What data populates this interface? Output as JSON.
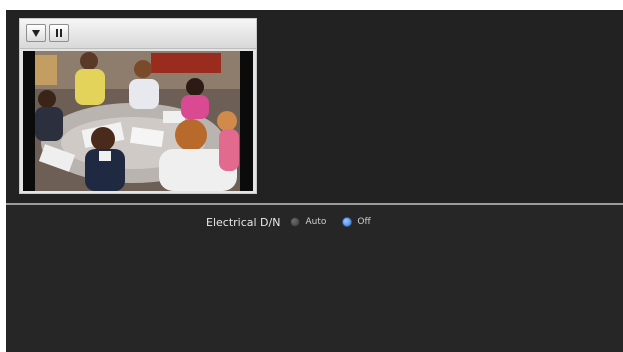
{
  "viewer": {
    "menu_icon": "triangle-down-icon",
    "pause_icon": "pause-icon",
    "menu_tooltip": "",
    "pause_tooltip": ""
  },
  "settings": {
    "electrical_dn": {
      "label": "Electrical D/N",
      "options": [
        {
          "label": "Auto",
          "selected": false
        },
        {
          "label": "Off",
          "selected": true
        }
      ]
    }
  },
  "colors": {
    "background": "#222222",
    "divider": "#9a9a9a",
    "radio_selected": "#3f7fd6",
    "radio_unselected": "#4a4a4a",
    "label_text": "#e8e8e8"
  }
}
